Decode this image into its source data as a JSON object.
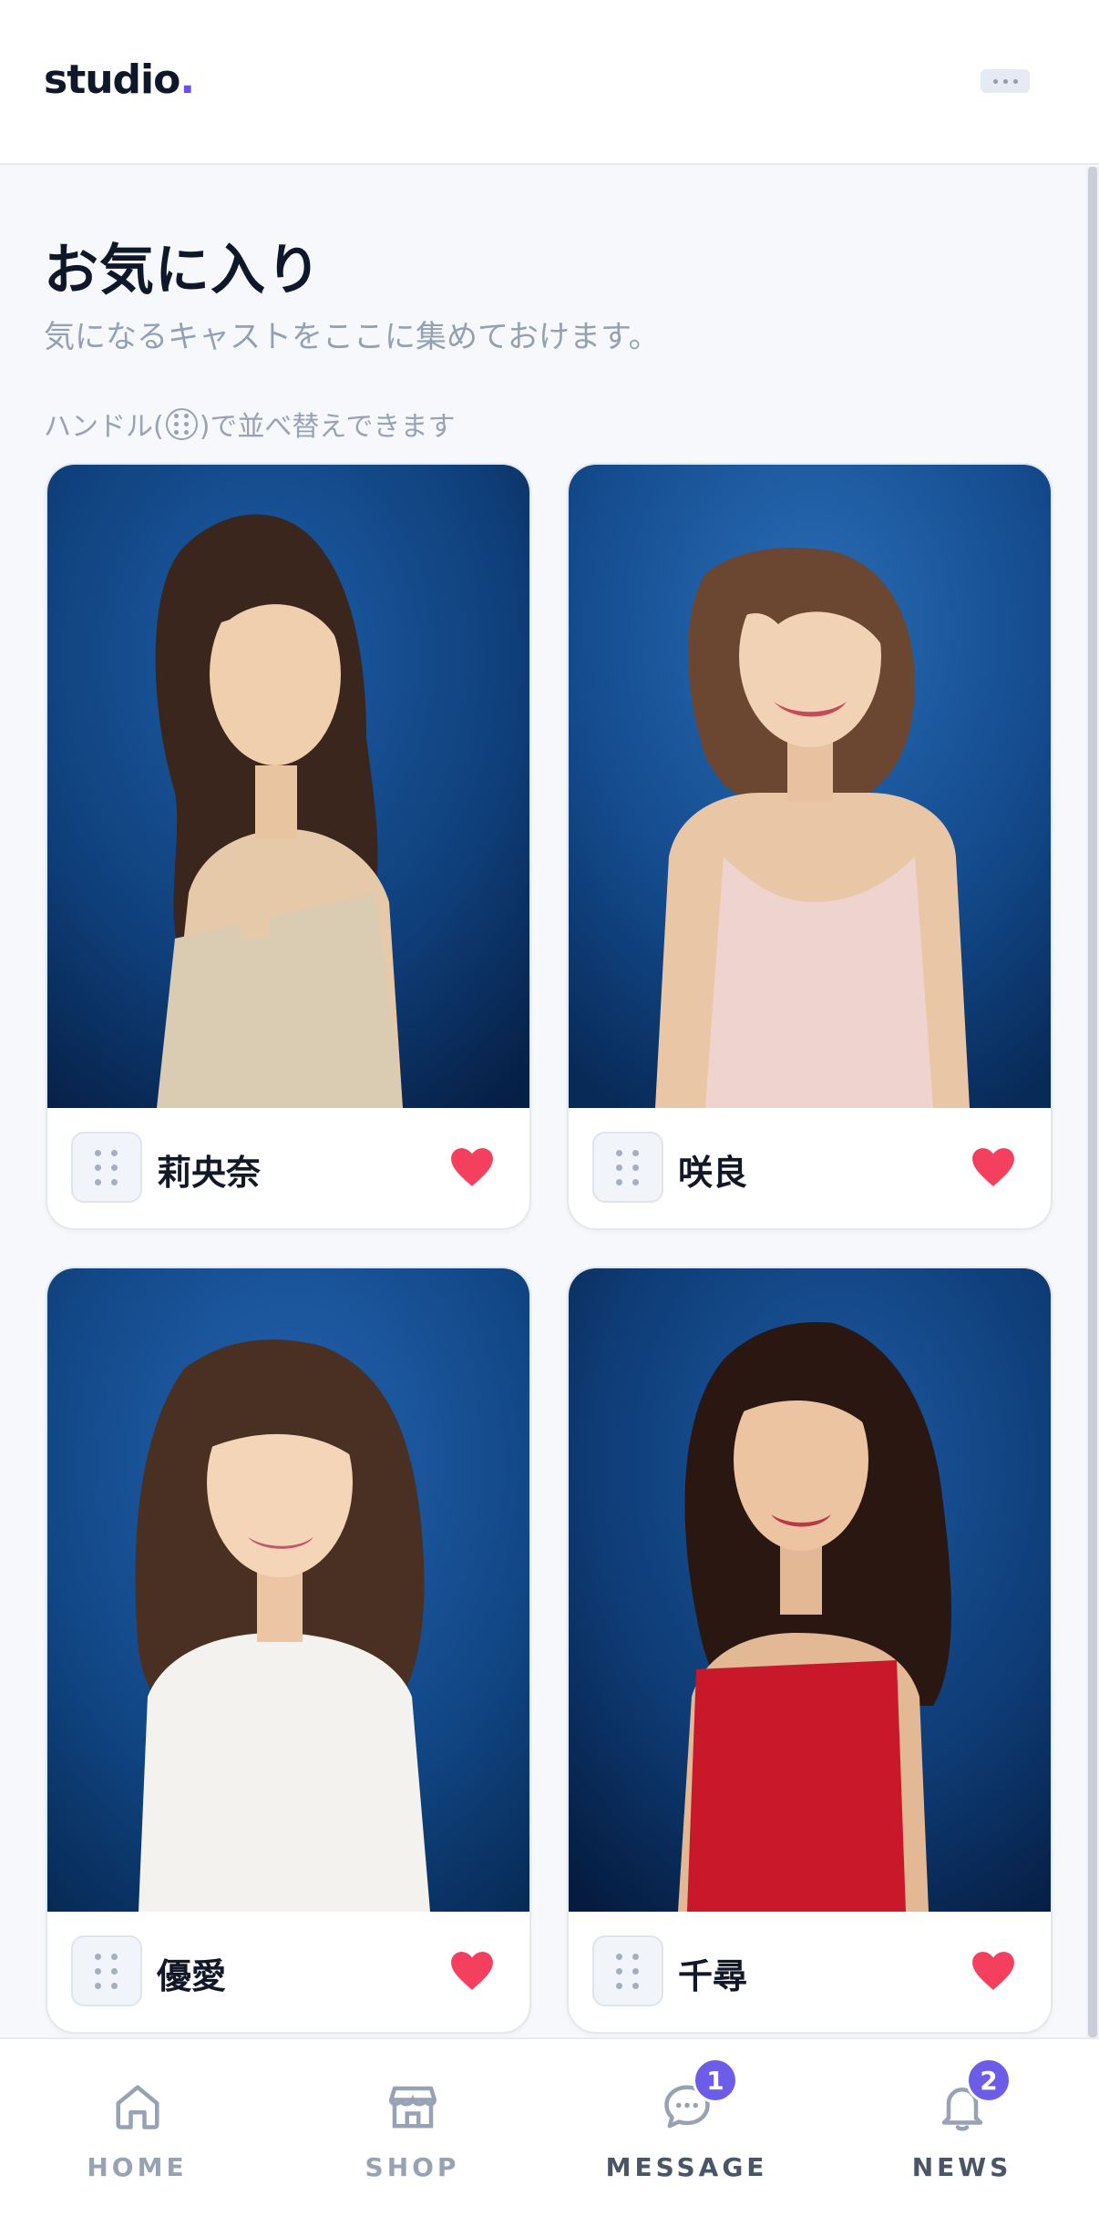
{
  "header": {
    "logo_text": "studio",
    "logo_dot": "."
  },
  "page": {
    "title": "お気に入り",
    "subtitle": "気になるキャストをここに集めておけます。",
    "hint_before": "ハンドル(",
    "hint_after": ")で並べ替えできます"
  },
  "cards": [
    {
      "name": "莉央奈",
      "dress_color": "#d9ccb2",
      "favorited": true
    },
    {
      "name": "咲良",
      "dress_color": "#efd3cf",
      "favorited": true
    },
    {
      "name": "優愛",
      "dress_color": "#f4f2ee",
      "favorited": true
    },
    {
      "name": "千尋",
      "dress_color": "#c8182a",
      "favorited": true
    }
  ],
  "nav": {
    "items": [
      {
        "label": "HOME",
        "icon": "home-icon"
      },
      {
        "label": "SHOP",
        "icon": "shop-icon"
      },
      {
        "label": "MESSAGE",
        "icon": "chat-icon",
        "badge": "1"
      },
      {
        "label": "NEWS",
        "icon": "bell-icon",
        "badge": "2"
      }
    ]
  },
  "colors": {
    "accent": "#6c5ce7",
    "heart": "#f43f5e",
    "photo_bg": "#0f3f7a"
  }
}
